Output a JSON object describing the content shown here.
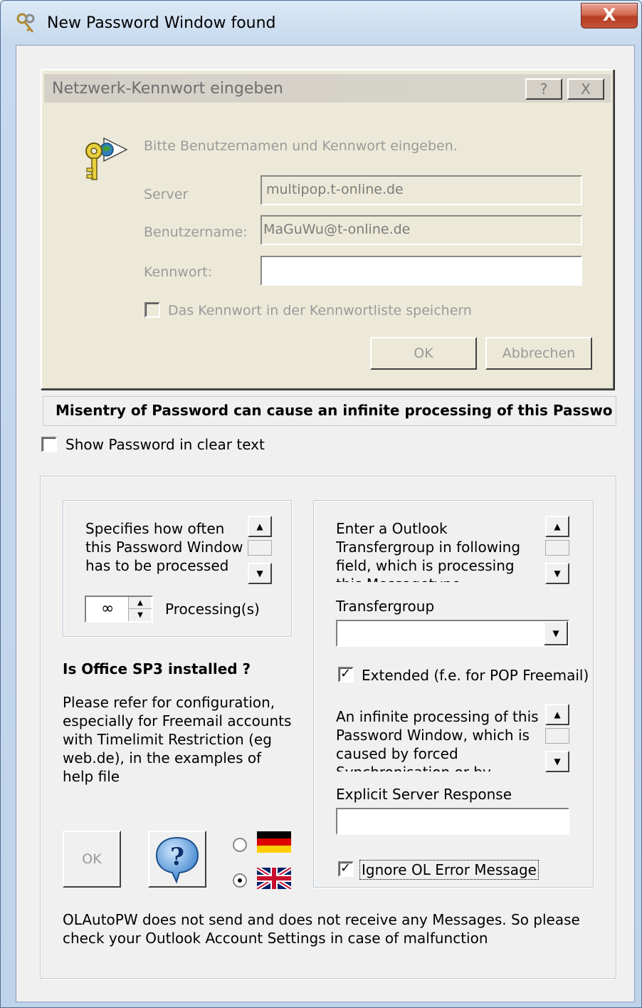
{
  "window": {
    "title": "New Password Window found",
    "close_label": "X"
  },
  "inner_dialog": {
    "title": "Netzwerk-Kennwort eingeben",
    "help_label": "?",
    "close_label": "X",
    "prompt": "Bitte Benutzernamen und Kennwort eingeben.",
    "server_label": "Server",
    "server_value": "multipop.t-online.de",
    "username_label": "Benutzername:",
    "username_value": "MaGuWu@t-online.de",
    "password_label": "Kennwort:",
    "password_value": "",
    "save_password_label": "Das Kennwort in der Kennwortliste speichern",
    "save_password_checked": false,
    "ok_label": "OK",
    "cancel_label": "Abbrechen"
  },
  "warning": {
    "text": "Misentry of Password can cause an infinite processing of this Passwo"
  },
  "show_password": {
    "label": "Show Password in clear text",
    "checked": false
  },
  "left_panel": {
    "processing_desc": "Specifies how often this Password Window has to be processed",
    "processing_value": "∞",
    "processing_unit": "Processing(s)",
    "sp3_heading": "Is Office SP3 installed ?",
    "sp3_text": "Please refer for configuration, especially for Freemail accounts with Timelimit Restriction (eg web.de), in the examples of help file",
    "ok_label": "OK",
    "help_icon_label": "?",
    "languages": [
      {
        "name": "German",
        "selected": false
      },
      {
        "name": "English",
        "selected": true
      }
    ]
  },
  "right_panel": {
    "transfergroup_desc": "Enter a Outlook Transfergroup in following field, which is processing this Messagetype (receiving/sending) of this",
    "transfergroup_label": "Transfergroup",
    "transfergroup_value": "",
    "extended_label": "Extended  (f.e. for POP Freemail)",
    "extended_checked": true,
    "infinite_desc": "An infinite processing of this Password Window, which is caused by forced Synchronisation or by Provider",
    "server_response_label": "Explicit Server Response",
    "server_response_value": "",
    "ignore_error_label": "Ignore OL Error Message",
    "ignore_error_checked": true
  },
  "footer": {
    "text": "OLAutoPW does not send and does not receive any Messages. So please check your Outlook Account Settings in case of malfunction"
  },
  "colors": {
    "titlebar": "#c6d9ee",
    "close_button": "#c4543a",
    "dialog_face": "#ece9d8",
    "client_bg": "#f0f0f0"
  }
}
